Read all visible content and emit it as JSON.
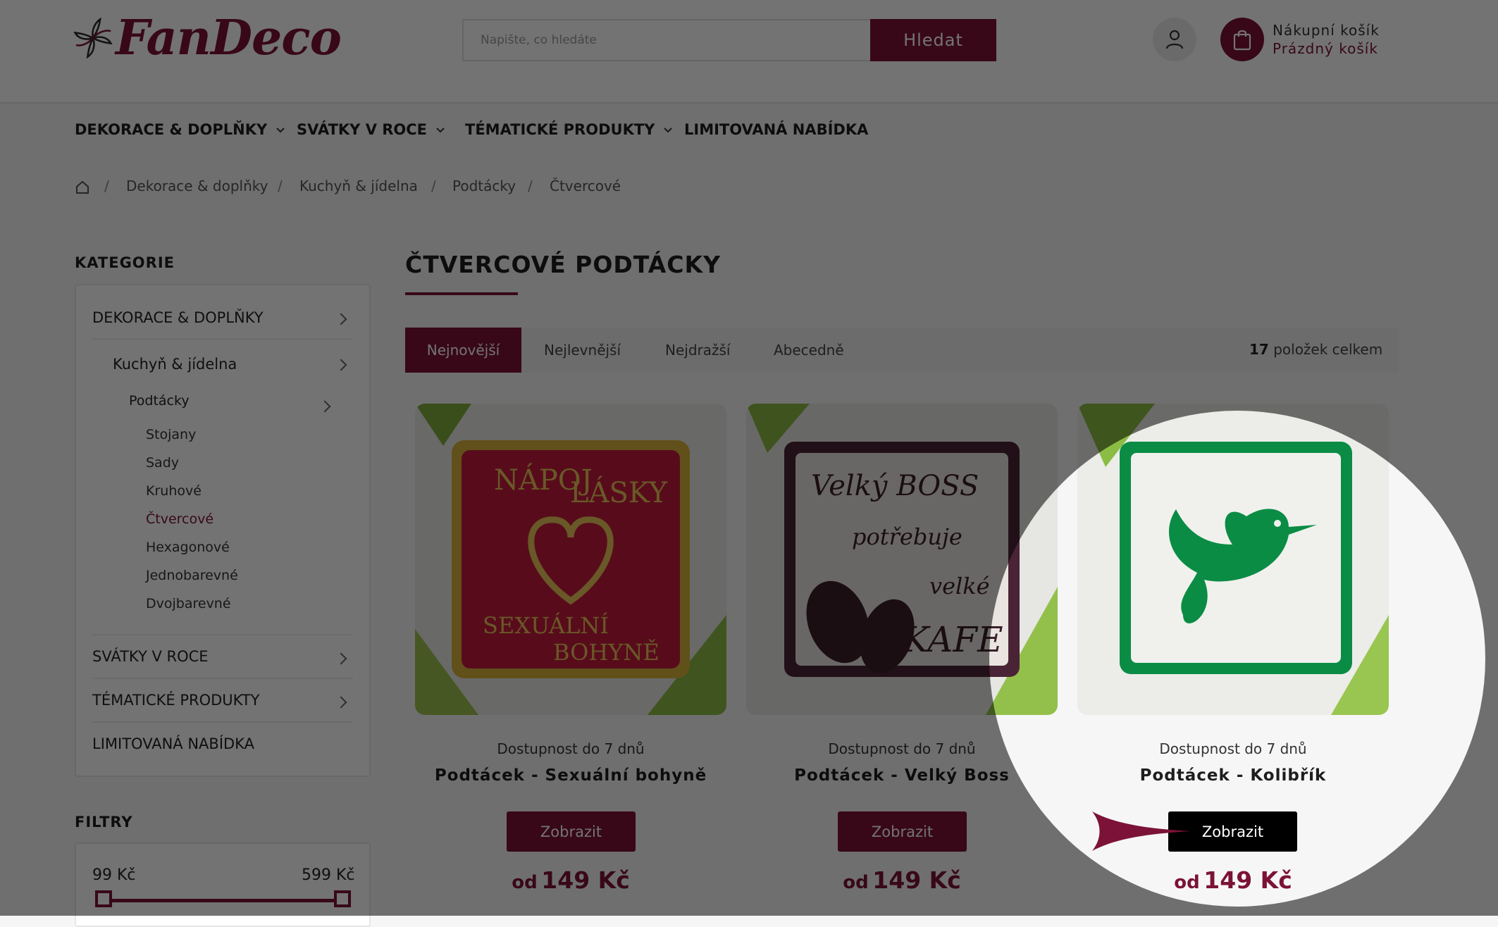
{
  "header": {
    "logo_text": "FanDeco",
    "search": {
      "placeholder": "Napište, co hledáte",
      "button_label": "Hledat"
    },
    "cart": {
      "title": "Nákupní košík",
      "status": "Prázdný košík"
    }
  },
  "nav": {
    "items": [
      {
        "label": "DEKORACE & DOPLŇKY"
      },
      {
        "label": "SVÁTKY V ROCE"
      },
      {
        "label": "TÉMATICKÉ PRODUKTY"
      },
      {
        "label": "LIMITOVANÁ NABÍDKA"
      }
    ]
  },
  "breadcrumb": [
    "Dekorace & doplňky",
    "Kuchyň & jídelna",
    "Podtácky",
    "Čtvercové"
  ],
  "sidebar": {
    "categories_heading": "KATEGORIE",
    "top_items": [
      "DEKORACE & DOPLŇKY",
      "SVÁTKY V ROCE",
      "TÉMATICKÉ PRODUKTY",
      "LIMITOVANÁ NABÍDKA"
    ],
    "level2": "Kuchyň & jídelna",
    "level3": "Podtácky",
    "subitems": [
      "Stojany",
      "Sady",
      "Kruhové",
      "Čtvercové",
      "Hexagonové",
      "Jednobarevné",
      "Dvojbarevné"
    ],
    "active_subitem": "Čtvercové",
    "filters_heading": "FILTRY",
    "price_min": "99 Kč",
    "price_max": "599 Kč"
  },
  "main": {
    "title": "ČTVERCOVÉ PODTÁCKY",
    "sort_tabs": [
      "Nejnovější",
      "Nejlevnější",
      "Nejdražší",
      "Abecedně"
    ],
    "active_sort": "Nejnovější",
    "total_count": "17",
    "total_label": "položek celkem",
    "products": [
      {
        "availability": "Dostupnost do 7 dnů",
        "name": "Podtácek - Sexuální bohyně",
        "button": "Zobrazit",
        "price_prefix": "od",
        "price": "149 Kč",
        "image_text": [
          "NÁPOJ",
          "LÁSKY",
          "SEXUÁLNÍ",
          "BOHYNĚ"
        ]
      },
      {
        "availability": "Dostupnost do 7 dnů",
        "name": "Podtácek - Velký Boss",
        "button": "Zobrazit",
        "price_prefix": "od",
        "price": "149 Kč",
        "image_text": [
          "Velký BOSS",
          "potřebuje",
          "velké",
          "KAFE"
        ]
      },
      {
        "availability": "Dostupnost do 7 dnů",
        "name": "Podtácek - Kolibřík",
        "button": "Zobrazit",
        "price_prefix": "od",
        "price": "149 Kč"
      }
    ]
  },
  "colors": {
    "accent": "#7c1237",
    "highlight_button": "#000000",
    "overlay": "rgba(0,0,0,0.55)"
  },
  "icons": [
    "logo-flower-icon",
    "user-icon",
    "shopping-bag-icon",
    "home-icon",
    "chevron-down-icon",
    "chevron-right-icon",
    "pointer-arrow-icon"
  ]
}
